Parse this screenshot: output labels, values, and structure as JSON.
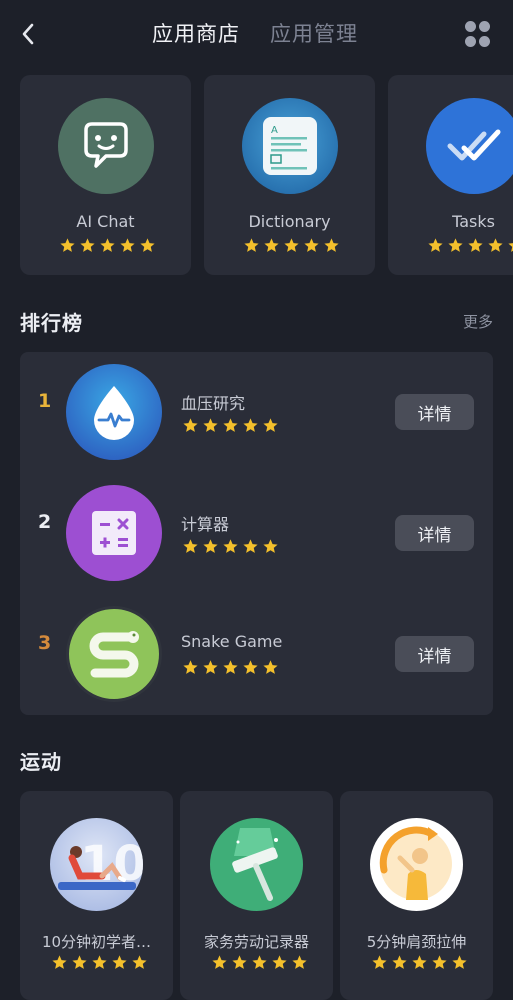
{
  "header": {
    "tabs": [
      {
        "label": "应用商店",
        "active": true
      },
      {
        "label": "应用管理",
        "active": false
      }
    ],
    "icons": {
      "back": "chevron-left-icon",
      "menu": "four-dots-grid-icon"
    }
  },
  "featured": {
    "items": [
      {
        "name": "AI Chat",
        "rating": 5,
        "icon": "chat-bubble-face-icon",
        "color": "#4f7163"
      },
      {
        "name": "Dictionary",
        "rating": 5,
        "icon": "dictionary-book-icon",
        "color": "#2d6da3"
      },
      {
        "name": "Tasks",
        "rating": 5,
        "icon": "double-check-icon",
        "color": "#2e73d8"
      }
    ]
  },
  "ranking": {
    "title": "排行榜",
    "more_label": "更多",
    "items": [
      {
        "rank": "1",
        "name": "血压研究",
        "rating": 5,
        "button": "详情",
        "icon": "blood-drop-icon",
        "rank_color": "#e9b43a"
      },
      {
        "rank": "2",
        "name": "计算器",
        "rating": 5,
        "button": "详情",
        "icon": "calculator-icon",
        "rank_color": "#eceef3"
      },
      {
        "rank": "3",
        "name": "Snake Game",
        "rating": 5,
        "button": "详情",
        "icon": "snake-icon",
        "rank_color": "#d48a3c"
      }
    ]
  },
  "sports": {
    "title": "运动",
    "items": [
      {
        "name": "10分钟初学者…",
        "rating": 5,
        "icon": "situp-workout-icon"
      },
      {
        "name": "家务劳动记录器",
        "rating": 5,
        "icon": "mop-cleaning-icon"
      },
      {
        "name": "5分钟肩颈拉伸",
        "rating": 5,
        "icon": "neck-stretch-icon"
      }
    ]
  },
  "colors": {
    "background": "#1d2029",
    "card": "#2a2d38",
    "star": "#f4c02c",
    "button": "#4a4d58"
  }
}
